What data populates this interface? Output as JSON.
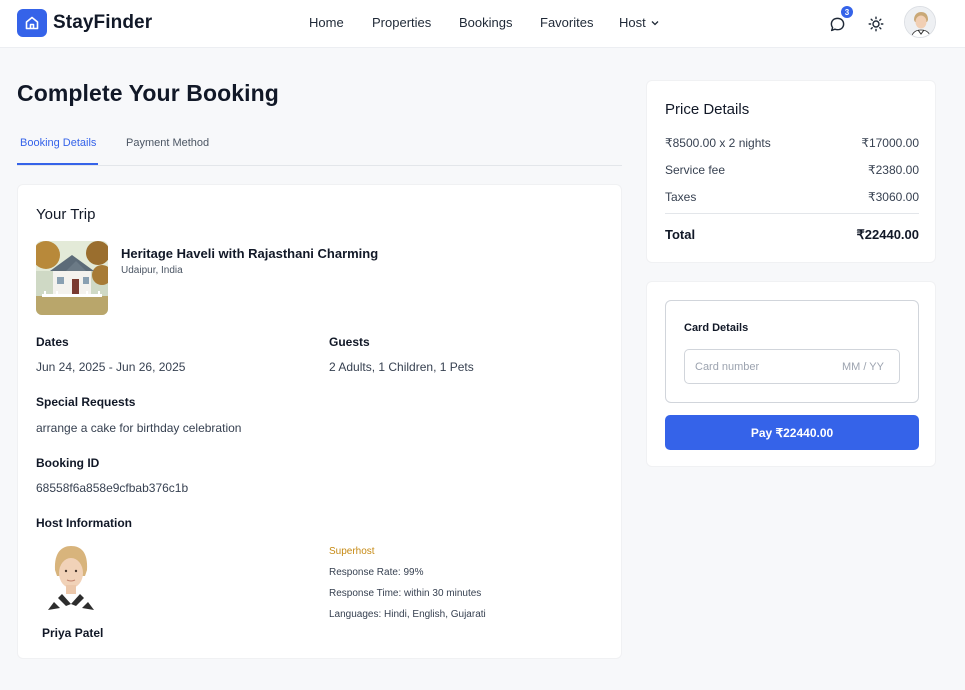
{
  "brand": {
    "name": "StayFinder",
    "logo_icon": "home-icon",
    "accent": "#3563e9"
  },
  "nav": {
    "items": [
      {
        "label": "Home"
      },
      {
        "label": "Properties"
      },
      {
        "label": "Bookings"
      },
      {
        "label": "Favorites"
      },
      {
        "label": "Host"
      }
    ]
  },
  "header": {
    "message_badge": "3",
    "icons": [
      "message-icon",
      "sun-icon",
      "user-avatar"
    ]
  },
  "page": {
    "title": "Complete Your Booking"
  },
  "tabs": [
    {
      "label": "Booking Details",
      "active": true
    },
    {
      "label": "Payment Method",
      "active": false
    }
  ],
  "trip": {
    "title": "Your Trip",
    "property": {
      "name": "Heritage Haveli with Rajasthani Charming",
      "location": "Udaipur, India"
    },
    "dates_label": "Dates",
    "dates_value": "Jun 24, 2025 - Jun 26, 2025",
    "guests_label": "Guests",
    "guests_value": "2 Adults, 1 Children, 1 Pets",
    "requests_label": "Special Requests",
    "requests_value": "arrange a cake for birthday celebration",
    "booking_id_label": "Booking ID",
    "booking_id_value": "68558f6a858e9cfbab376c1b",
    "host_label": "Host Information",
    "host": {
      "name": "Priya Patel",
      "superhost": "Superhost",
      "response_rate": "Response Rate: 99%",
      "response_time": "Response Time: within 30 minutes",
      "languages": "Languages: Hindi, English, Gujarati"
    }
  },
  "price": {
    "title": "Price Details",
    "rows": [
      {
        "label": "₹8500.00 x 2 nights",
        "value": "₹17000.00"
      },
      {
        "label": "Service fee",
        "value": "₹2380.00"
      },
      {
        "label": "Taxes",
        "value": "₹3060.00"
      }
    ],
    "total_label": "Total",
    "total_value": "₹22440.00"
  },
  "payment": {
    "card_title": "Card Details",
    "card_number_placeholder": "Card number",
    "expiry_placeholder": "MM / YY",
    "pay_button": "Pay ₹22440.00"
  }
}
